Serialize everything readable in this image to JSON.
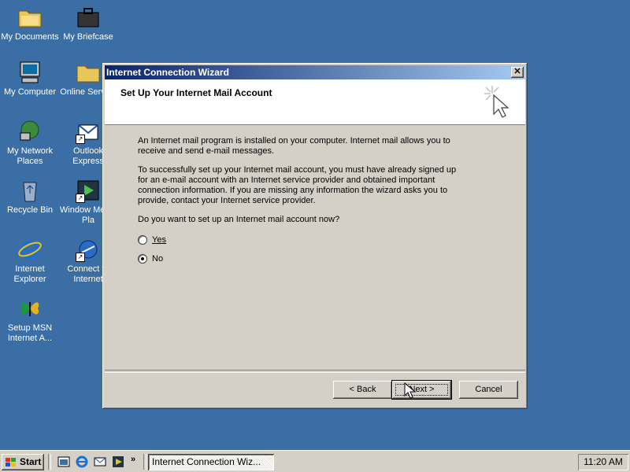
{
  "desktop": {
    "icons": [
      {
        "label": "My Documents"
      },
      {
        "label": "My Briefcase"
      },
      {
        "label": "My Computer"
      },
      {
        "label": "Online Service"
      },
      {
        "label": "My Network Places"
      },
      {
        "label": "Outlook Express"
      },
      {
        "label": "Recycle Bin"
      },
      {
        "label": "Window Media Pla"
      },
      {
        "label": "Internet Explorer"
      },
      {
        "label": "Connect to Internet"
      },
      {
        "label": "Setup MSN Internet A..."
      }
    ]
  },
  "wizard": {
    "title": "Internet Connection Wizard",
    "close_glyph": "✕",
    "header_title": "Set Up Your Internet Mail Account",
    "para1": "An Internet mail program is installed on your computer. Internet mail allows you to receive and send e-mail messages.",
    "para2": "To successfully set up your Internet mail account, you must have already signed up for an e-mail account with an Internet service provider and obtained important connection information. If you are missing any information the wizard asks you to provide, contact your Internet service provider.",
    "question": "Do you want to set up an Internet mail account now?",
    "options": [
      {
        "label": "Yes",
        "checked": false
      },
      {
        "label": "No",
        "checked": true
      }
    ],
    "buttons": {
      "back": "< Back",
      "next": "Next >",
      "cancel": "Cancel"
    }
  },
  "taskbar": {
    "start_label": "Start",
    "chevron": "»",
    "task_label": "Internet Connection Wiz...",
    "clock": "11:20 AM"
  }
}
